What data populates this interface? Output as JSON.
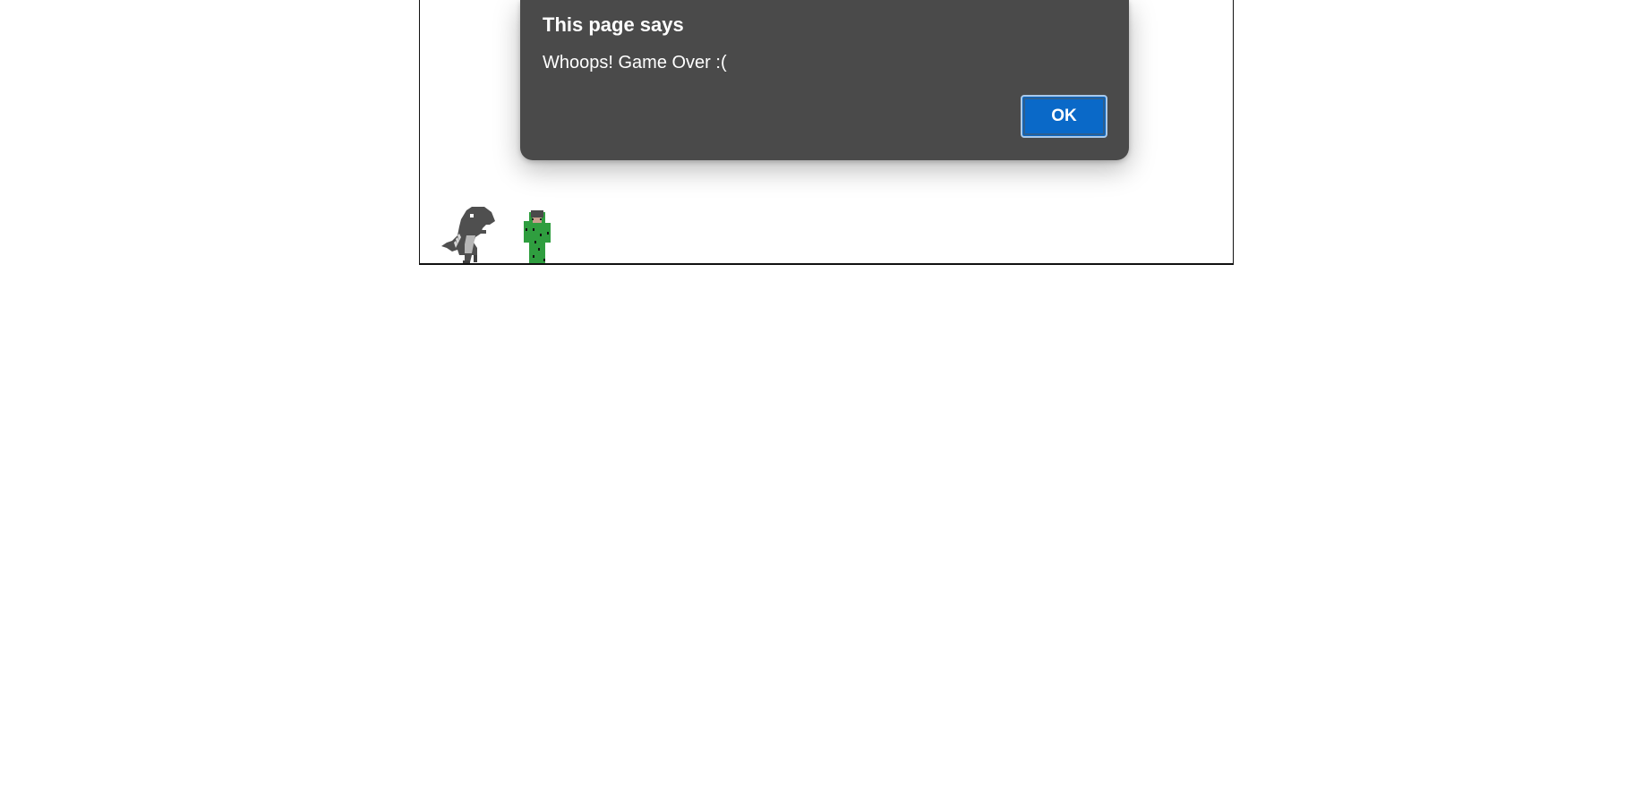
{
  "dialog": {
    "title": "This page says",
    "message": "Whoops! Game Over :(",
    "ok_label": "OK"
  },
  "colors": {
    "dialog_background": "#4a4a4a",
    "ok_button": "#0a69c8",
    "dino": "#4f4f4f",
    "cactus": "#2f9e3f"
  },
  "icons": {
    "player": "dino-sprite",
    "obstacle": "cactus-sprite"
  }
}
